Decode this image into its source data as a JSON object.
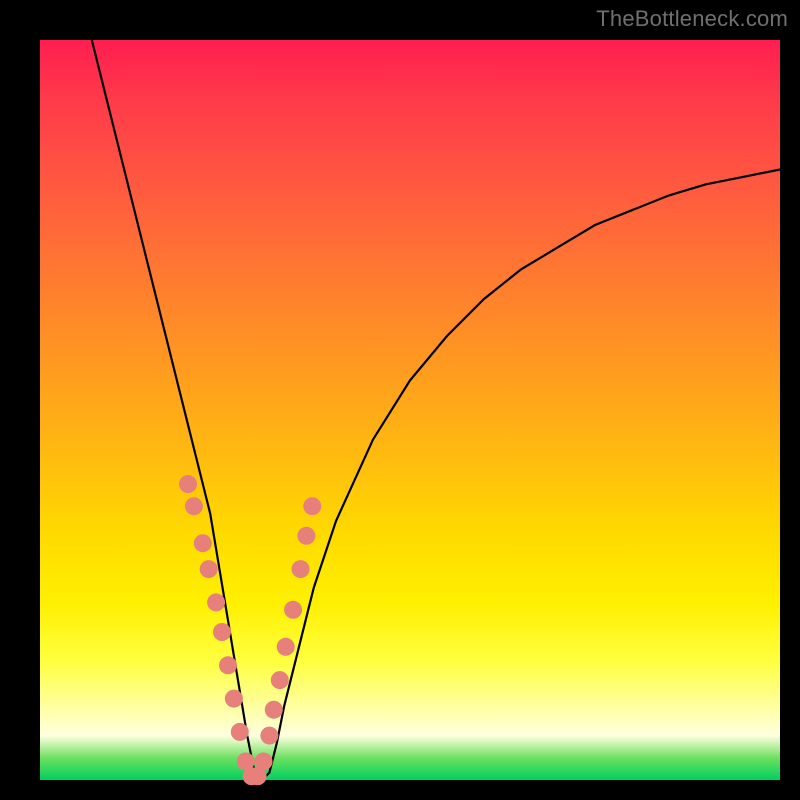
{
  "watermark": "TheBottleneck.com",
  "chart_data": {
    "type": "line",
    "title": "",
    "xlabel": "",
    "ylabel": "",
    "xlim": [
      0,
      100
    ],
    "ylim": [
      0,
      100
    ],
    "series": [
      {
        "name": "bottleneck-curve",
        "x": [
          7,
          9,
          11,
          13,
          15,
          17,
          19,
          21,
          23,
          24,
          25,
          26,
          27,
          28,
          29,
          30,
          31,
          32,
          33,
          35,
          37,
          40,
          45,
          50,
          55,
          60,
          65,
          70,
          75,
          80,
          85,
          90,
          95,
          100
        ],
        "y": [
          100,
          92,
          84,
          76,
          68,
          60,
          52,
          44,
          36,
          30,
          24,
          18,
          12,
          6,
          1,
          0,
          1,
          5,
          10,
          18,
          26,
          35,
          46,
          54,
          60,
          65,
          69,
          72,
          75,
          77,
          79,
          80.5,
          81.5,
          82.5
        ]
      }
    ],
    "highlight_points": {
      "name": "salmon-dots",
      "color": "#e77f7b",
      "x": [
        20.0,
        20.8,
        22.0,
        22.8,
        23.8,
        24.6,
        25.4,
        26.2,
        27.0,
        27.8,
        28.6,
        29.4,
        30.2,
        31.0,
        31.6,
        32.4,
        33.2,
        34.2,
        35.2,
        36.0,
        36.8
      ],
      "y": [
        40.0,
        37.0,
        32.0,
        28.5,
        24.0,
        20.0,
        15.5,
        11.0,
        6.5,
        2.5,
        0.5,
        0.5,
        2.5,
        6.0,
        9.5,
        13.5,
        18.0,
        23.0,
        28.5,
        33.0,
        37.0
      ]
    },
    "gradient_stops": [
      {
        "pos": 0.0,
        "color": "#ff1e50"
      },
      {
        "pos": 0.5,
        "color": "#ffba10"
      },
      {
        "pos": 0.8,
        "color": "#ffff40"
      },
      {
        "pos": 0.97,
        "color": "#6fe060"
      },
      {
        "pos": 1.0,
        "color": "#00d060"
      }
    ]
  }
}
